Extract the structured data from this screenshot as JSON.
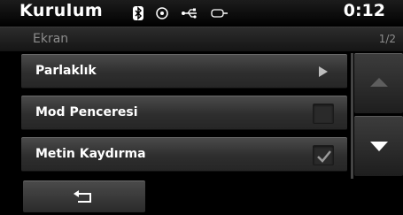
{
  "header": {
    "title": "Kurulum",
    "clock": "0:12",
    "status_icons": [
      "bluetooth-icon",
      "disc-icon",
      "usb-icon",
      "aux-icon"
    ]
  },
  "subheader": {
    "section": "Ekran",
    "page": "1/2"
  },
  "rows": [
    {
      "label": "Parlaklık",
      "control": "arrow"
    },
    {
      "label": "Mod Penceresi",
      "control": "checkbox",
      "checked": false
    },
    {
      "label": "Metin Kaydırma",
      "control": "checkbox",
      "checked": true
    }
  ],
  "scroll": {
    "up_enabled": false,
    "down_enabled": true
  },
  "footer": {
    "back_icon": "return-arrow-icon"
  },
  "colors": {
    "background": "#000000",
    "row": "#3a3a3a",
    "muted_text": "#8c8c8c"
  }
}
